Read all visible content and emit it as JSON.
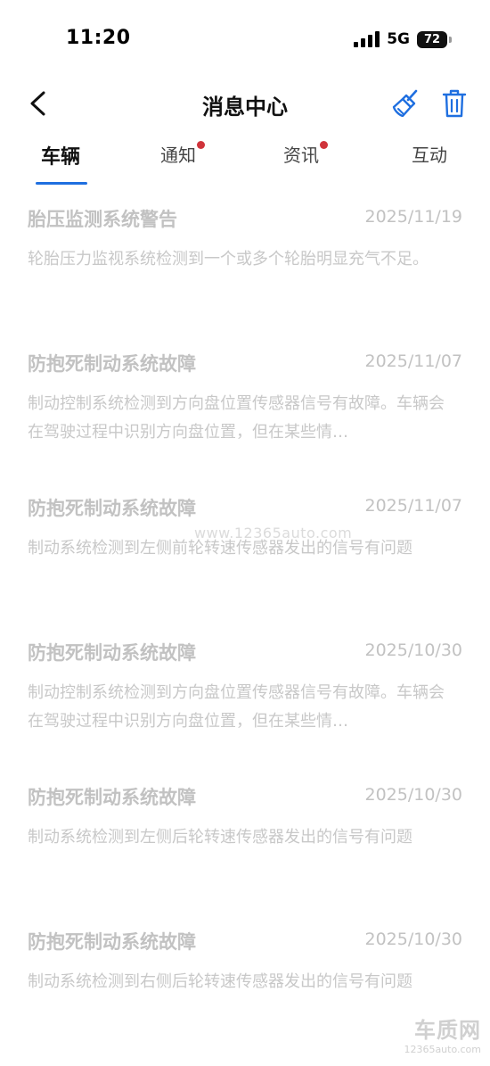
{
  "status_bar": {
    "time": "11:20",
    "network": "5G",
    "battery": "72"
  },
  "header": {
    "title": "消息中心",
    "back_icon": "chevron-left-icon",
    "clean_icon": "broom-icon",
    "delete_icon": "trash-icon",
    "accent_color": "#1f6fe0"
  },
  "tabs": [
    {
      "label": "车辆",
      "active": true,
      "badge": false
    },
    {
      "label": "通知",
      "active": false,
      "badge": true
    },
    {
      "label": "资讯",
      "active": false,
      "badge": true
    },
    {
      "label": "互动",
      "active": false,
      "badge": false
    }
  ],
  "badge_color": "#d0343b",
  "messages": [
    {
      "title": "胎压监测系统警告",
      "date": "2025/11/19",
      "body": "轮胎压力监视系统检测到一个或多个轮胎明显充气不足。"
    },
    {
      "title": "防抱死制动系统故障",
      "date": "2025/11/07",
      "body": "制动控制系统检测到方向盘位置传感器信号有故障。车辆会在驾驶过程中识别方向盘位置，但在某些情…"
    },
    {
      "title": "防抱死制动系统故障",
      "date": "2025/11/07",
      "body": "制动系统检测到左侧前轮转速传感器发出的信号有问题"
    },
    {
      "title": "防抱死制动系统故障",
      "date": "2025/10/30",
      "body": "制动控制系统检测到方向盘位置传感器信号有故障。车辆会在驾驶过程中识别方向盘位置，但在某些情…"
    },
    {
      "title": "防抱死制动系统故障",
      "date": "2025/10/30",
      "body": "制动系统检测到左侧后轮转速传感器发出的信号有问题"
    },
    {
      "title": "防抱死制动系统故障",
      "date": "2025/10/30",
      "body": "制动系统检测到右侧后轮转速传感器发出的信号有问题"
    }
  ],
  "watermark": {
    "center_text": "www.12365auto.com",
    "brand": "车质网",
    "url": "12365auto.com"
  }
}
